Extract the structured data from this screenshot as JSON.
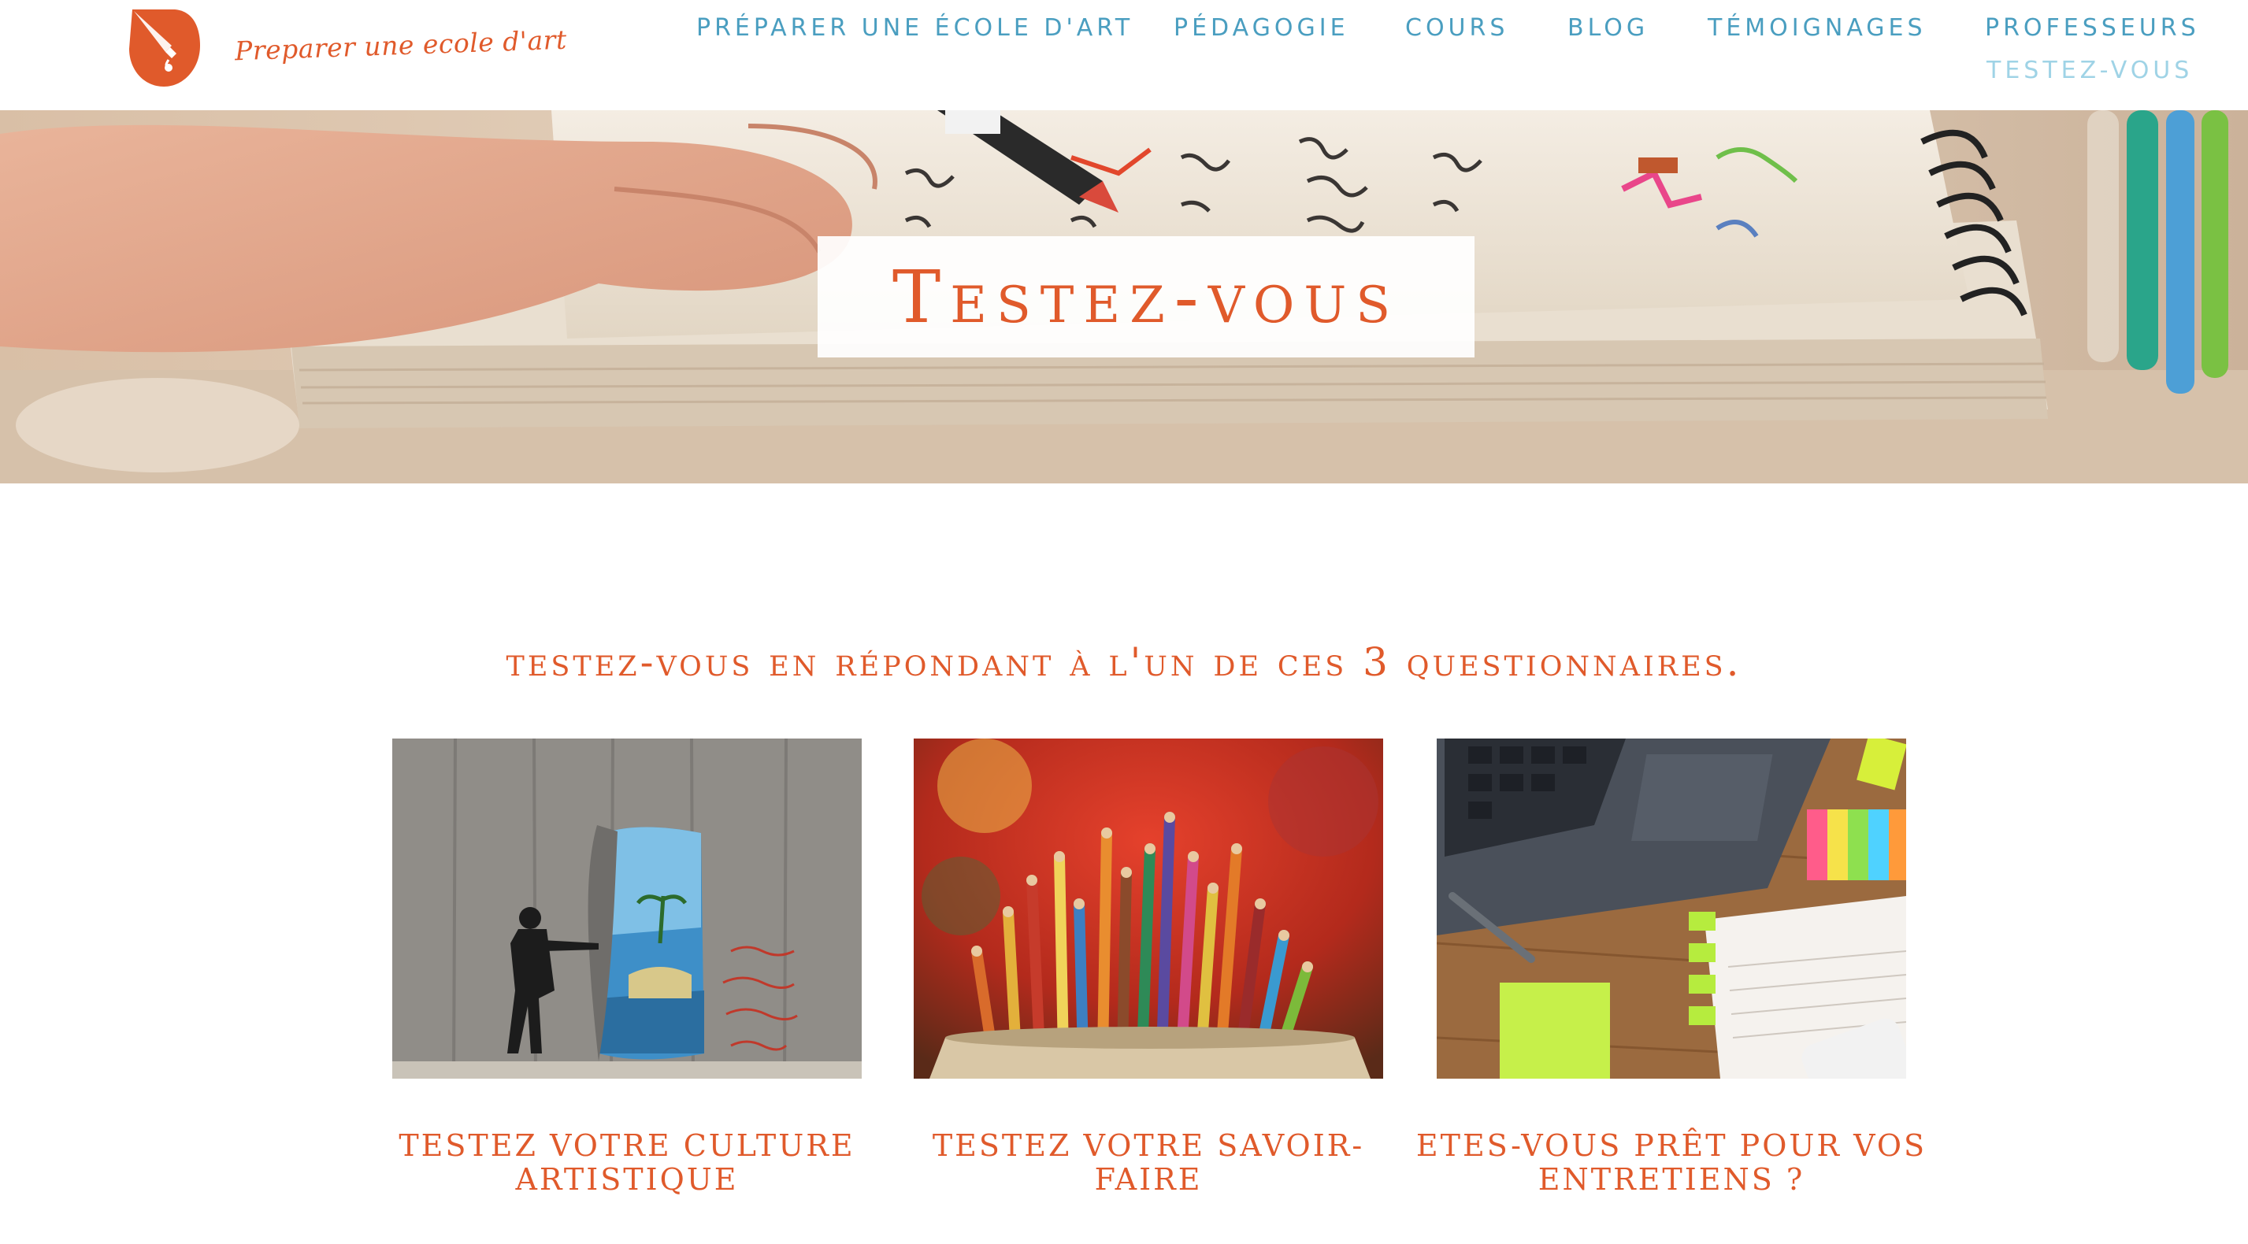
{
  "brand": {
    "logo_text": "Preparer une ecole d'art",
    "accent_color": "#e05a2b",
    "nav_color": "#4a9ec0"
  },
  "nav": {
    "items": [
      {
        "label": "PRÉPARER UNE ÉCOLE D'ART"
      },
      {
        "label": "PÉDAGOGIE"
      },
      {
        "label": "COURS"
      },
      {
        "label": "BLOG"
      },
      {
        "label": "TÉMOIGNAGES"
      },
      {
        "label": "PROFESSEURS"
      },
      {
        "label": "TESTEZ-VOUS",
        "active": true
      }
    ]
  },
  "hero": {
    "title": "Testez-vous"
  },
  "main": {
    "intro": "testez-vous en répondant à l'un de ces 3 questionnaires.",
    "cards": [
      {
        "title": "TESTEZ VOTRE CULTURE ARTISTIQUE",
        "image_icon": "street-art-wall-image"
      },
      {
        "title": "TESTEZ VOTRE SAVOIR-FAIRE",
        "image_icon": "colored-pencils-image"
      },
      {
        "title": "ETES-VOUS PRÊT POUR VOS ENTRETIENS ?",
        "image_icon": "laptop-desk-notes-image"
      }
    ]
  }
}
